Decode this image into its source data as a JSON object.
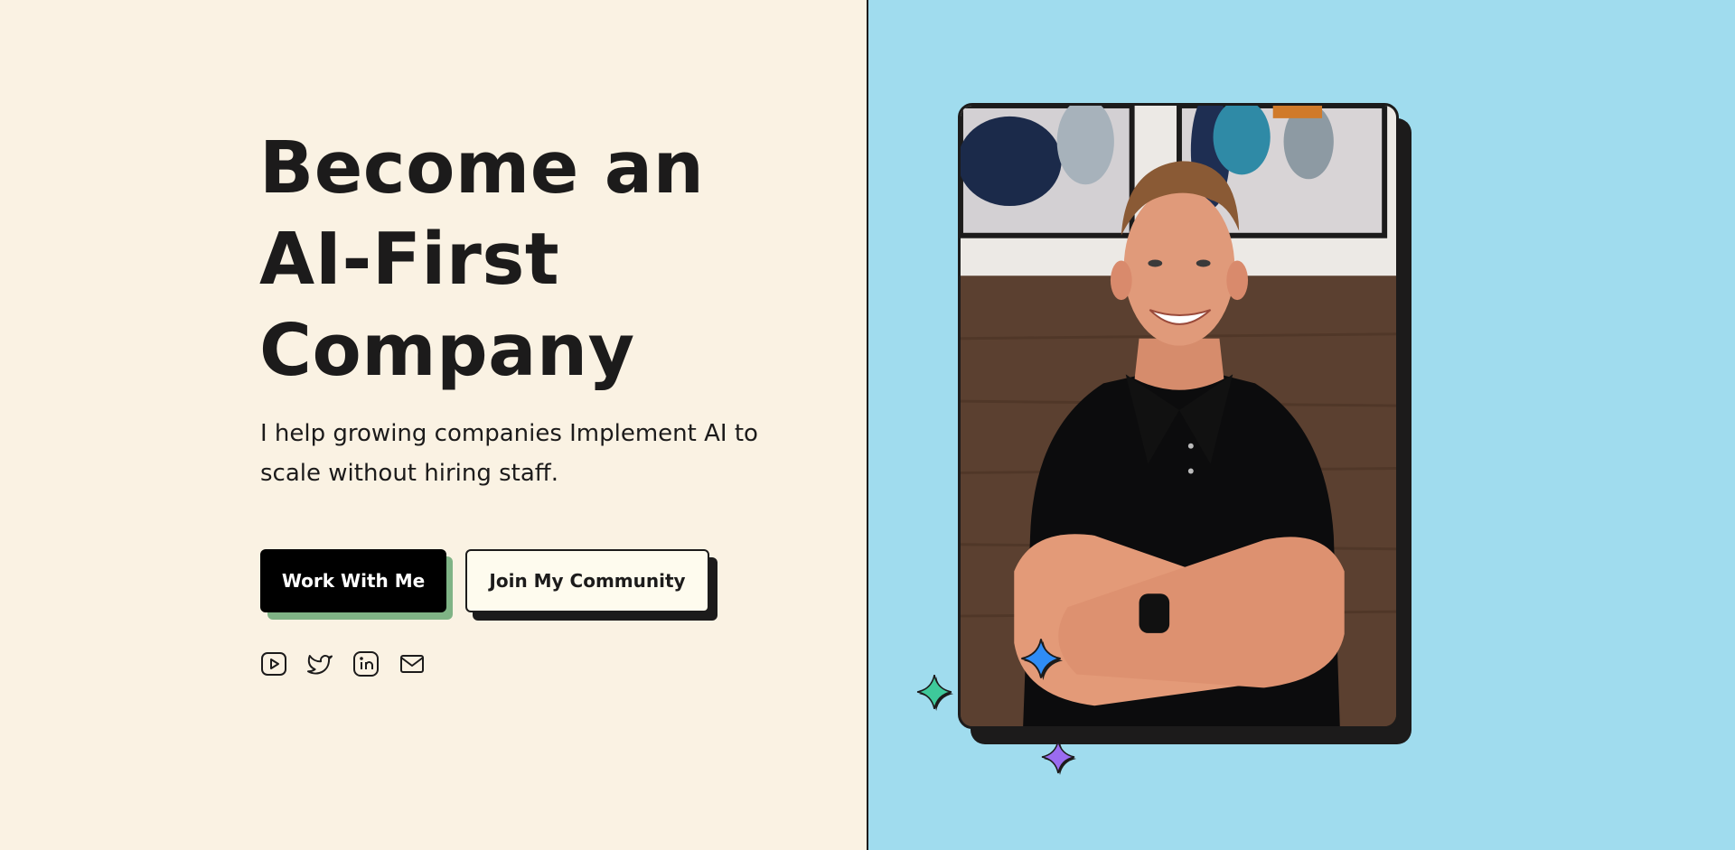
{
  "hero": {
    "title_lines": [
      "Become an",
      "AI-First",
      "Company"
    ],
    "subtitle": "I help growing companies Implement AI to scale without hiring staff."
  },
  "buttons": {
    "primary_label": "Work With Me",
    "secondary_label": "Join My Community"
  },
  "social_icons": [
    "youtube-icon",
    "twitter-icon",
    "linkedin-icon",
    "mail-icon"
  ],
  "photo": {
    "alt": "Portrait of a smiling man in a black polo shirt with arms crossed"
  },
  "decorations": [
    "sparkle-green-icon",
    "sparkle-blue-icon",
    "sparkle-purple-icon"
  ],
  "colors": {
    "left_bg": "#faf2e3",
    "right_bg": "#a0dcee",
    "text": "#1c1b1b",
    "primary_button": "#000000",
    "primary_button_shadow": "#7fb385",
    "secondary_button": "#fefbee",
    "sparkle_green": "#3ec99a",
    "sparkle_blue": "#2f8cf5",
    "sparkle_purple": "#9a6cf0"
  }
}
